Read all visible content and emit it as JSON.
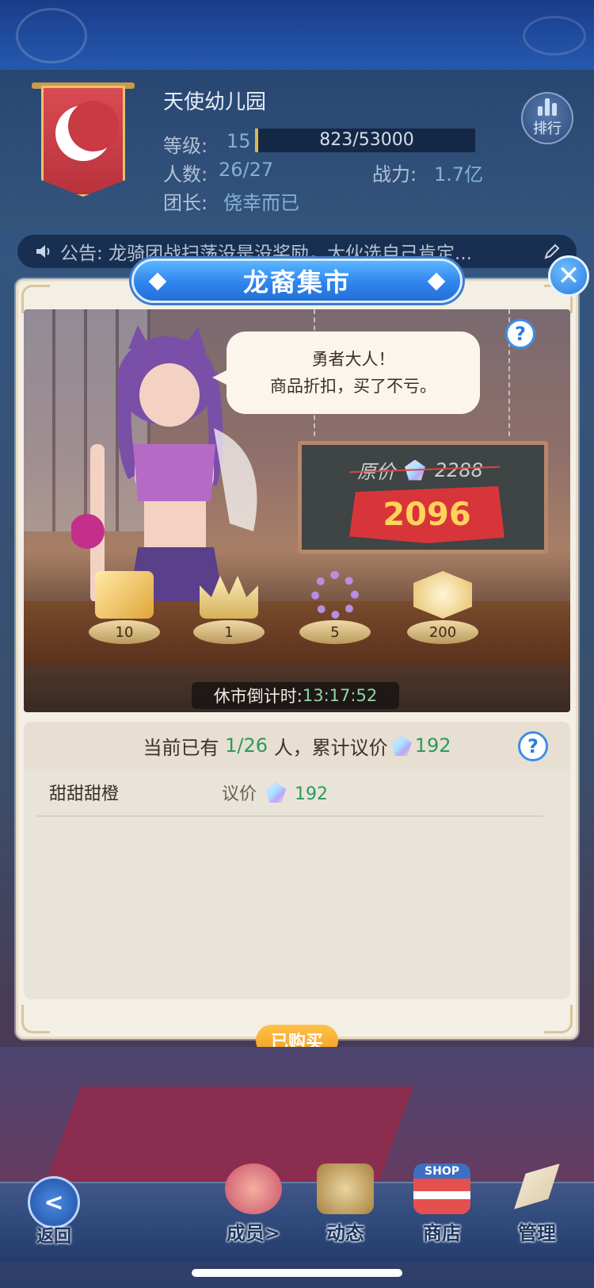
{
  "guild": {
    "name": "天使幼儿园",
    "level_label": "等级:",
    "level": "15",
    "xp": "823/53000",
    "members_label": "人数:",
    "members": "26/27",
    "power_label": "战力:",
    "power": "1.7亿",
    "leader_label": "团长:",
    "leader": "侥幸而已",
    "rank_button": "排行"
  },
  "notice": {
    "text": "公告: 龙骑团战扫荡没是没奖励，大伙选自己肯定..."
  },
  "modal": {
    "title": "龙裔集市",
    "close_symbol": "✕",
    "speech_line1": "勇者大人！",
    "speech_line2": "商品折扣，买了不亏。",
    "help_symbol": "?",
    "original_price_label": "原价",
    "original_price": "2288",
    "current_price": "2096",
    "items": [
      {
        "icon": "crystal-icon",
        "count": "10"
      },
      {
        "icon": "crown-icon",
        "count": "1"
      },
      {
        "icon": "bracelet-icon",
        "count": "5"
      },
      {
        "icon": "winged-badge-icon",
        "count": "200"
      }
    ],
    "countdown_label": "休市倒计时:",
    "countdown_time": "13:17:52",
    "summary_prefix": "当前已有",
    "summary_count": "1/26",
    "summary_mid": "人，累计议价",
    "summary_total": "192",
    "bids": [
      {
        "name": "甜甜甜橙",
        "label": "议价",
        "amount": "192"
      }
    ],
    "bought_button": "已购买"
  },
  "nav": {
    "back": "返回",
    "members": "成员>",
    "activity": "动态",
    "shop": "商店",
    "shop_sign": "SHOP",
    "manage": "管理"
  },
  "colors": {
    "title_blue": "#2f84ee",
    "price_red": "#d8353a",
    "price_gold": "#ffd45a",
    "green_value": "#2e9a5c",
    "button_orange": "#f29b1c"
  }
}
